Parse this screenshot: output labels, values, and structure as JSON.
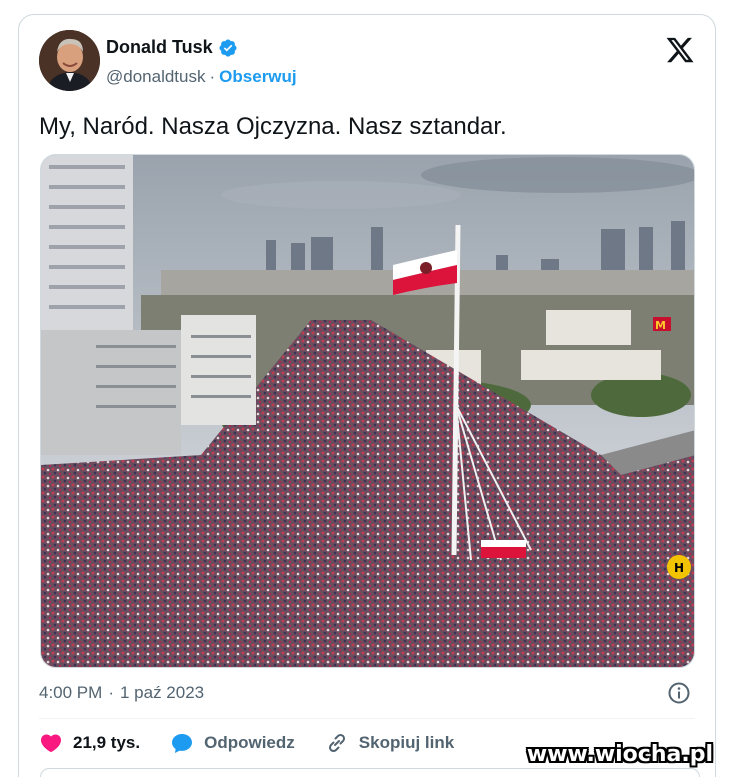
{
  "tweet": {
    "author_name": "Donald Tusk",
    "handle": "@donaldtusk",
    "separator": "·",
    "follow_label": "Obserwuj",
    "text": "My, Naród. Nasza Ojczyzna. Nasz sztandar.",
    "time": "4:00 PM",
    "date_separator": "·",
    "date": "1 paź 2023"
  },
  "actions": {
    "likes_count": "21,9 tys.",
    "reply_label": "Odpowiedz",
    "copy_link_label": "Skopiuj link"
  },
  "icons": {
    "verified": "verified-badge-icon",
    "x_logo": "x-logo-icon",
    "info": "info-icon",
    "heart": "heart-icon",
    "reply": "reply-bubble-icon",
    "link": "link-icon"
  },
  "colors": {
    "accent": "#1d9bf0",
    "like": "#f91880",
    "muted": "#536471",
    "flag_white": "#ffffff",
    "flag_red": "#dc143c"
  },
  "watermark": "www.wiocha.pl"
}
